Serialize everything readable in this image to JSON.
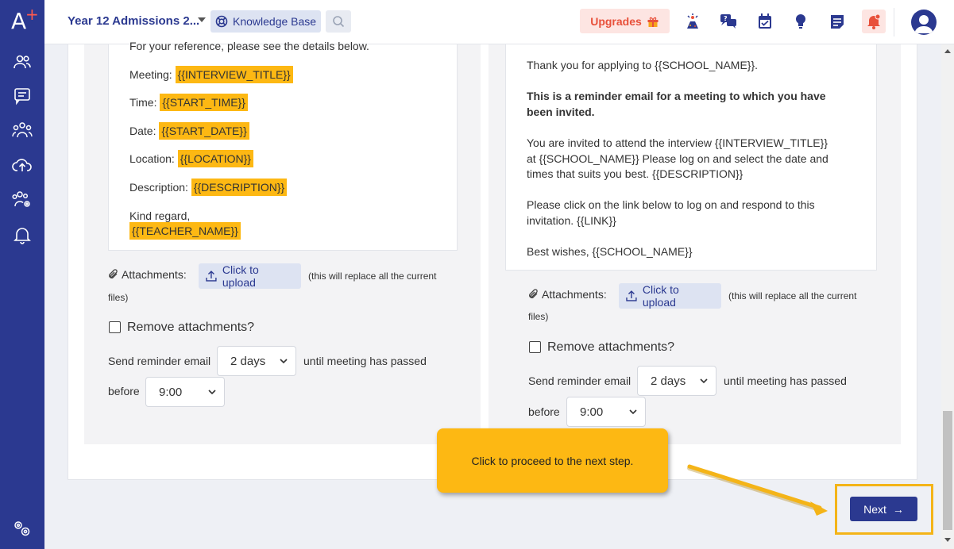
{
  "sidebar": {
    "logo": "A",
    "logo_mark": "+"
  },
  "header": {
    "title": "Year 12 Admissions 2...",
    "knowledge_base": "Knowledge Base",
    "upgrades": "Upgrades"
  },
  "left_panel": {
    "lines": {
      "reference": "For your reference, please see the details below.",
      "meeting_label": "Meeting:",
      "meeting_tag": "{{INTERVIEW_TITLE}}",
      "time_label": "Time:",
      "time_tag": "{{START_TIME}}",
      "date_label": "Date:",
      "date_tag": "{{START_DATE}}",
      "location_label": "Location:",
      "location_tag": "{{LOCATION}}",
      "description_label": "Description:",
      "description_tag": "{{DESCRIPTION}}",
      "kind_regard": "Kind regard,",
      "teacher_tag": "{{TEACHER_NAME}}"
    },
    "attachments_label": "Attachments:",
    "upload_label": "Click to upload",
    "replace_note": "(this will replace all the current",
    "replace_note2": "files)",
    "remove_attachments": "Remove attachments?",
    "send_reminder": "Send reminder email",
    "days_value": "2 days",
    "until_text": "until meeting has passed",
    "before_text": "before",
    "time_value": "9:00"
  },
  "right_panel": {
    "lines": {
      "thanks": "Thank you for applying to {{SCHOOL_NAME}}.",
      "reminder_1": "This is a reminder email for a meeting to which you have",
      "reminder_2": "been invited.",
      "invite_1": "You are invited to attend the interview {{INTERVIEW_TITLE}}",
      "invite_2": "at {{SCHOOL_NAME}} Please log on and select the date and",
      "invite_3": "times that suits you best. {{DESCRIPTION}}",
      "click_1": "Please click on the link below to log on and respond to this",
      "click_2": "invitation. {{LINK}}",
      "wishes": "Best wishes, {{SCHOOL_NAME}}"
    },
    "attachments_label": "Attachments:",
    "upload_label": "Click to upload",
    "replace_note": "(this will replace all the current",
    "replace_note2": "files)",
    "remove_attachments": "Remove attachments?",
    "send_reminder": "Send reminder email",
    "days_value": "2 days",
    "until_text": "until meeting has passed",
    "before_text": "before",
    "time_value": "9:00"
  },
  "tooltip": {
    "text": "Click to proceed to the next step."
  },
  "footer": {
    "next_label": "Next",
    "next_arrow": "→"
  },
  "colors": {
    "brand": "#2b3990",
    "highlight": "#fdb813",
    "alert": "#e8503a"
  }
}
